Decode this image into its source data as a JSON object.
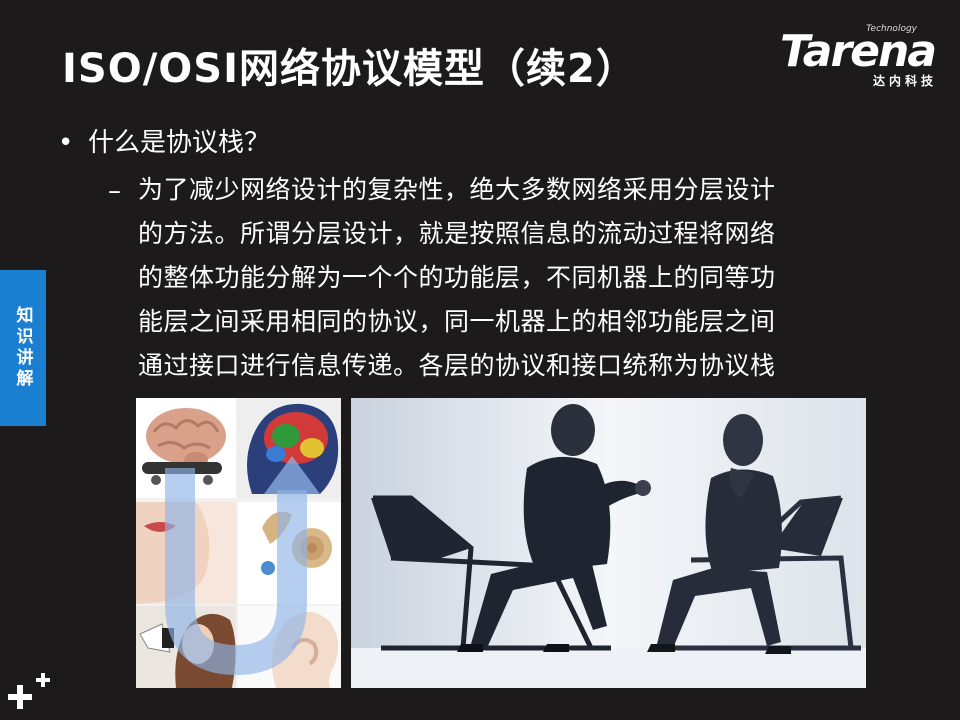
{
  "slide": {
    "title": "ISO/OSI网络协议模型（续2）"
  },
  "logo": {
    "tagline": "Technology",
    "wordmark": "Tarena",
    "cn_name": "达内科技"
  },
  "bullet": {
    "marker": "•",
    "text": "什么是协议栈？"
  },
  "sub": {
    "marker": "–",
    "lines": [
      "为了减少网络设计的复杂性，绝大多数网络采用分层设计",
      "的方法。所谓分层设计，就是按照信息的流动过程将网络",
      "的整体功能分解为一个个的功能层，不同机器上的同等功",
      "能层之间采用相同的协议，同一机器上的相邻功能层之间",
      "通过接口进行信息传递。各层的协议和接口统称为协议栈"
    ]
  },
  "side_tab": {
    "label": "知识讲解"
  },
  "icons": {
    "plus": "plus-icon"
  },
  "colors": {
    "background": "#1c1a1a",
    "accent": "#1a7fd0",
    "text": "#ffffff"
  }
}
